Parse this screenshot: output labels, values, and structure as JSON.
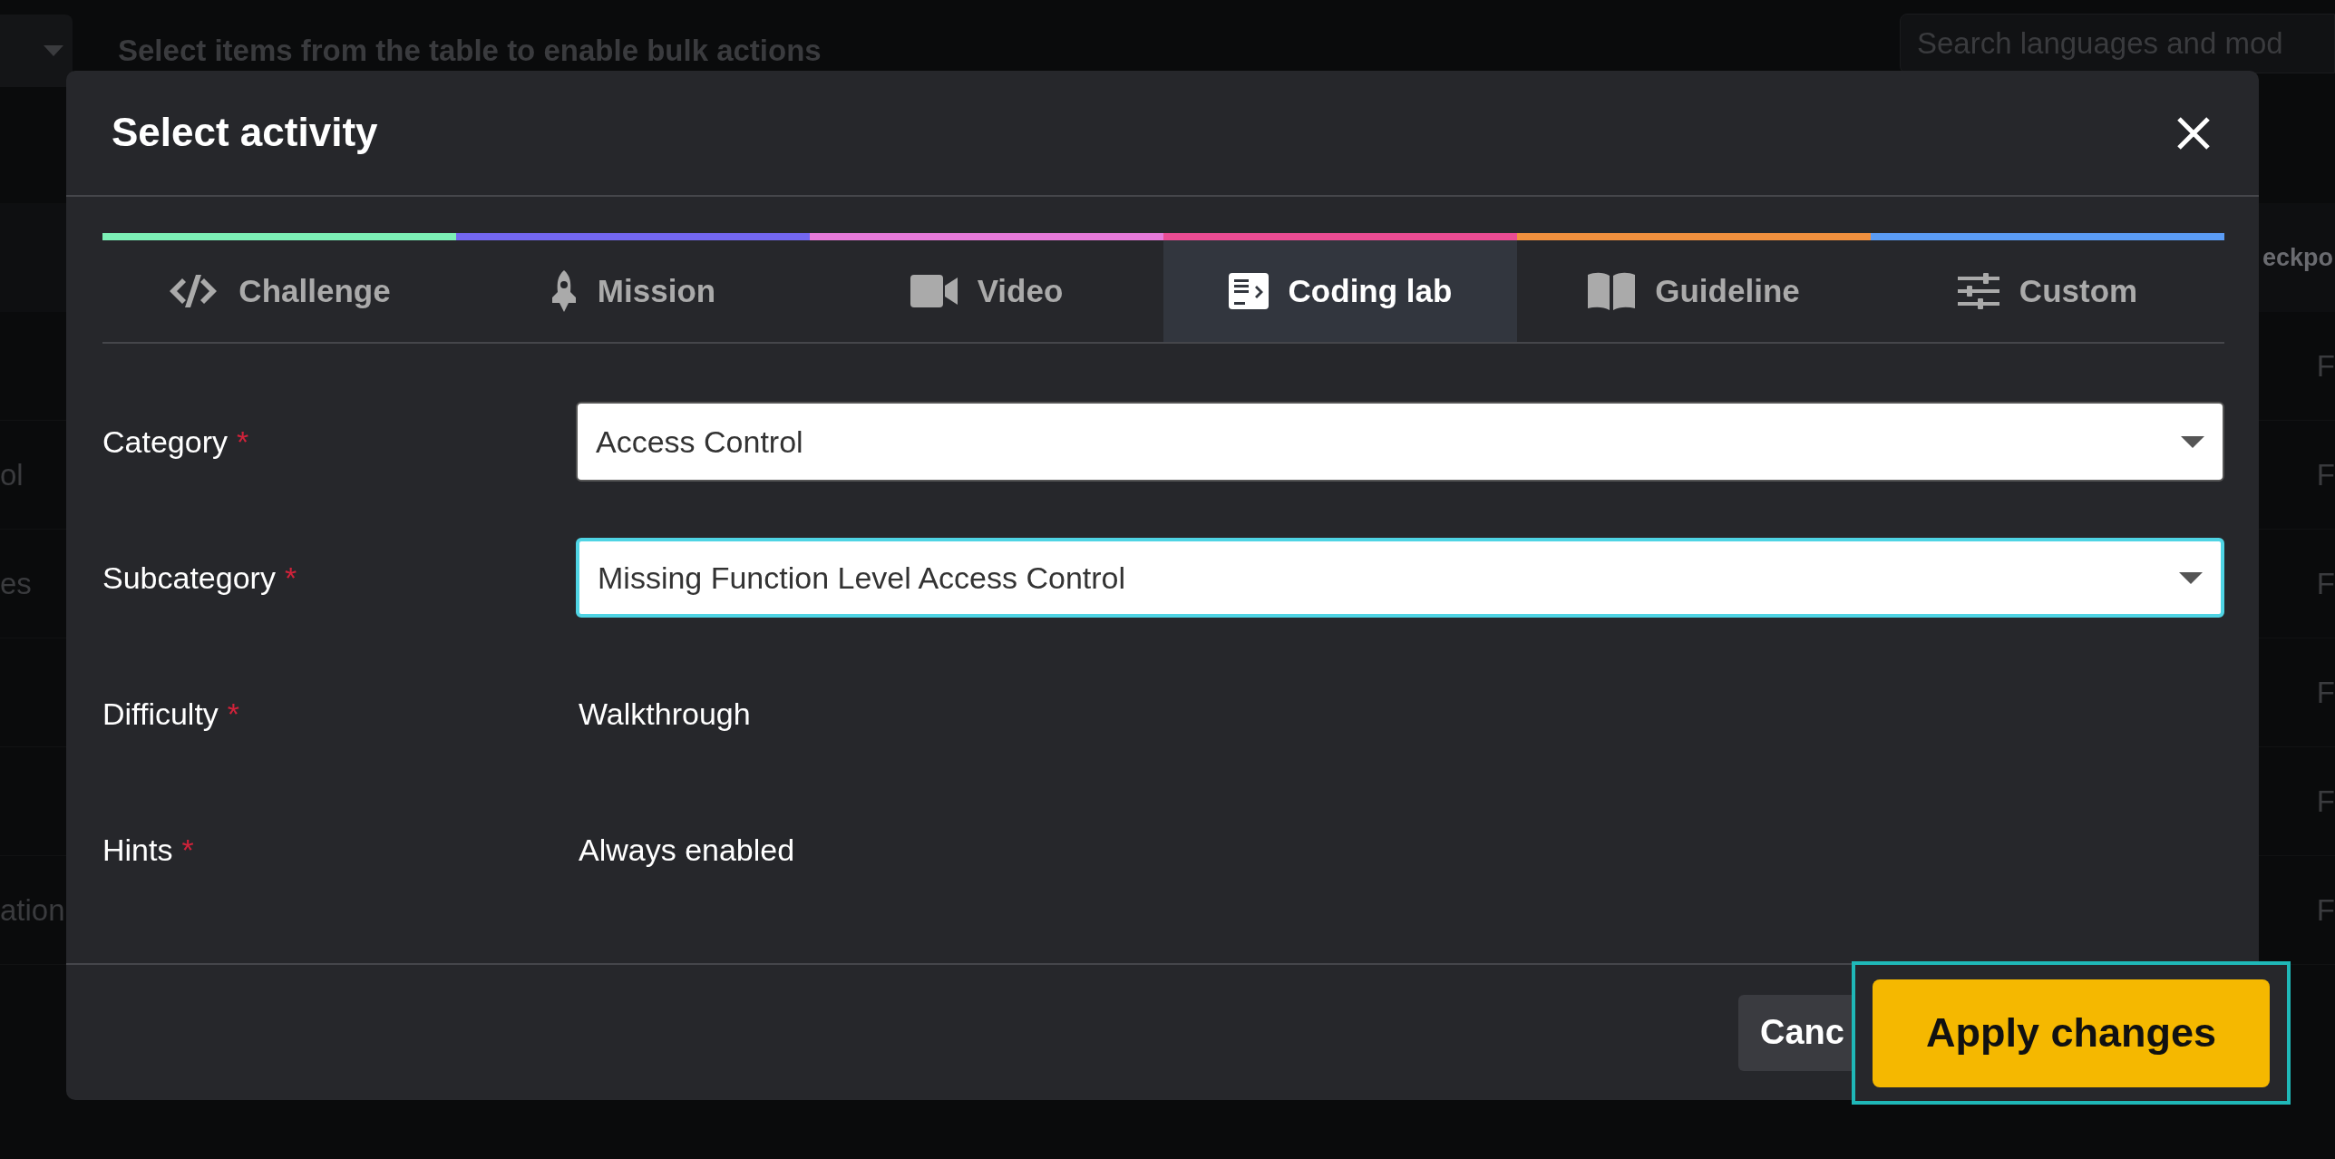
{
  "background": {
    "bulk_hint": "Select items from the table to enable bulk actions",
    "search": {
      "placeholder": "Search languages and mod"
    },
    "column_header": "eckpo",
    "rows": [
      {
        "right": "F"
      },
      {
        "left": "ol",
        "right": "F"
      },
      {
        "left": "es",
        "right": "F"
      },
      {
        "right": "F"
      },
      {
        "right": "F"
      },
      {
        "left": "ation",
        "right": "F"
      }
    ]
  },
  "modal": {
    "title": "Select activity",
    "tabs": [
      {
        "label": "Challenge",
        "kind": "code",
        "color": "#7cf0b6",
        "selected": false
      },
      {
        "label": "Mission",
        "kind": "rocket",
        "color": "#7367f0",
        "selected": false
      },
      {
        "label": "Video",
        "kind": "video",
        "color": "#e67ad9",
        "selected": false
      },
      {
        "label": "Coding lab",
        "kind": "lab",
        "color": "#ea4c93",
        "selected": true
      },
      {
        "label": "Guideline",
        "kind": "book",
        "color": "#f0903e",
        "selected": false
      },
      {
        "label": "Custom",
        "kind": "sliders",
        "color": "#5b9cf5",
        "selected": false
      }
    ],
    "fields": [
      {
        "label": "Category",
        "marker": "*",
        "kind": "select",
        "value": "Access Control",
        "focused": false
      },
      {
        "label": "Subcategory",
        "marker": "*",
        "kind": "select",
        "value": "Missing Function Level Access Control",
        "focused": true
      },
      {
        "label": "Difficulty",
        "marker": "*",
        "kind": "text",
        "value": "Walkthrough"
      },
      {
        "label": "Hints",
        "marker": "*",
        "kind": "text",
        "value": "Always enabled"
      }
    ],
    "buttons": [
      {
        "label": "Canc",
        "kind": "secondary"
      },
      {
        "label": "Apply changes",
        "kind": "primary",
        "focused": true
      }
    ]
  }
}
